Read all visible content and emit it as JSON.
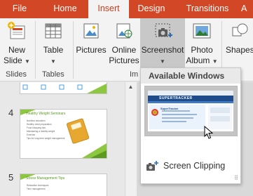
{
  "tabs": [
    {
      "label": "File",
      "active": false
    },
    {
      "label": "Home",
      "active": false
    },
    {
      "label": "Insert",
      "active": true
    },
    {
      "label": "Design",
      "active": false
    },
    {
      "label": "Transitions",
      "active": false
    },
    {
      "label": "A",
      "active": false
    }
  ],
  "ribbon": {
    "new_slide": {
      "line1": "New",
      "line2": "Slide",
      "icon": "new-slide-icon"
    },
    "table": {
      "line1": "Table",
      "icon": "table-icon"
    },
    "pictures": {
      "line1": "Pictures",
      "icon": "pictures-icon"
    },
    "online_pictures": {
      "line1": "Online",
      "line2": "Pictures",
      "icon": "online-pictures-icon"
    },
    "screenshot": {
      "line1": "Screenshot",
      "icon": "screenshot-icon"
    },
    "photo_album": {
      "line1": "Photo",
      "line2": "Album",
      "icon": "photo-album-icon"
    },
    "shapes": {
      "line1": "Shapes",
      "icon": "shapes-icon"
    },
    "groups": {
      "slides": "Slides",
      "tables": "Tables",
      "images": "Im"
    }
  },
  "slides": [
    {
      "number": "",
      "title": ""
    },
    {
      "number": "4",
      "title": "Healthy Weight Seminars",
      "bullets": [
        "Nutrition education",
        "Healthy meal preparation",
        "Food shopping tips",
        "Maintaining a healthy weight",
        "Exercise",
        "Tips for long-term weight management"
      ]
    },
    {
      "number": "5",
      "title": "Stress Management Tips",
      "bullets": [
        "Relaxation techniques",
        "Time management"
      ]
    }
  ],
  "dropdown": {
    "header": "Available Windows",
    "window_thumbnail": {
      "site_title": "SUPERTRACKER",
      "section_title": "SuperTracker"
    },
    "screen_clipping_label": "Screen Clipping"
  },
  "colors": {
    "tab_bar": "#d24726",
    "active_tab_text": "#c43e1c",
    "slide_accent": "#8dc63f"
  }
}
